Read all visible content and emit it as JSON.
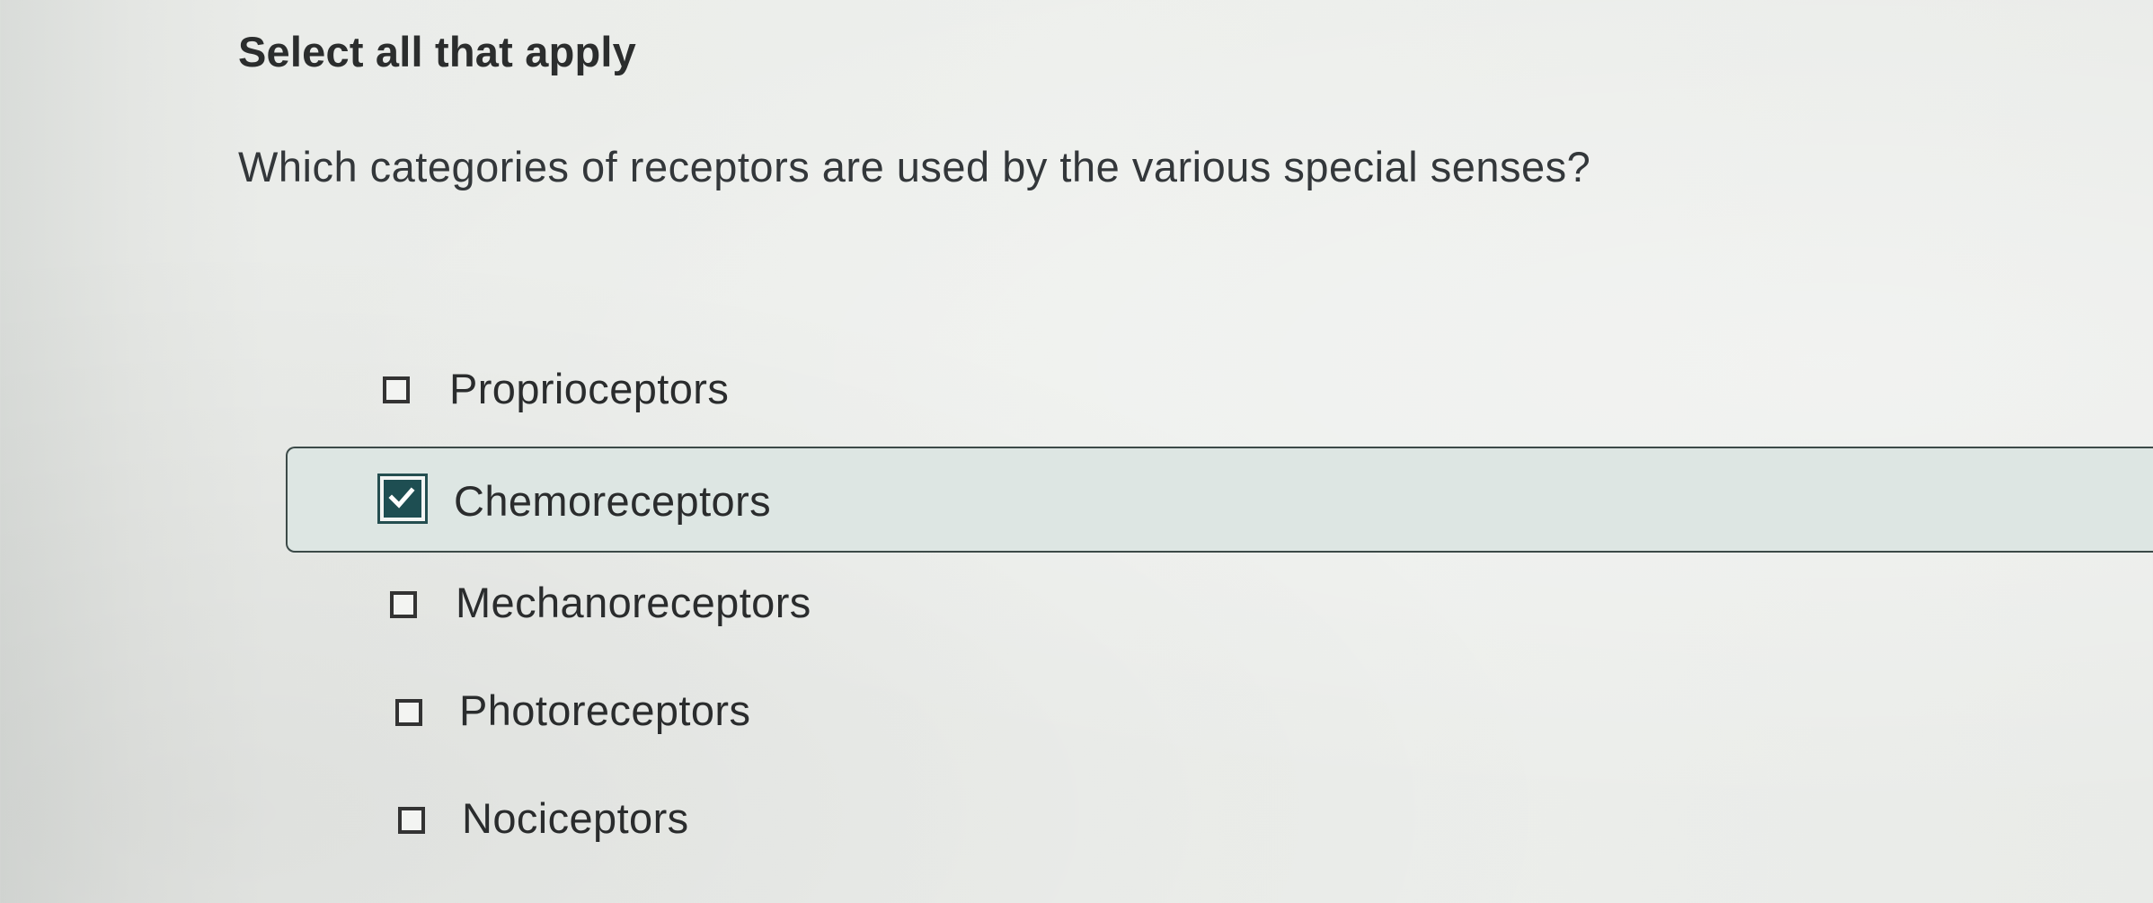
{
  "quiz": {
    "instruction": "Select all that apply",
    "question": "Which categories of receptors are used by the various special senses?",
    "options": [
      {
        "label": "Proprioceptors",
        "checked": false
      },
      {
        "label": "Chemoreceptors",
        "checked": true
      },
      {
        "label": "Mechanoreceptors",
        "checked": false
      },
      {
        "label": "Photoreceptors",
        "checked": false
      },
      {
        "label": "Nociceptors",
        "checked": false
      }
    ]
  },
  "colors": {
    "selected_background": "#dde6e3",
    "selected_border": "#3c4a48",
    "checkbox_checked_fill": "#1e4e52"
  },
  "icons": {
    "unchecked": "checkbox-empty-icon",
    "checked": "checkmark-icon"
  }
}
